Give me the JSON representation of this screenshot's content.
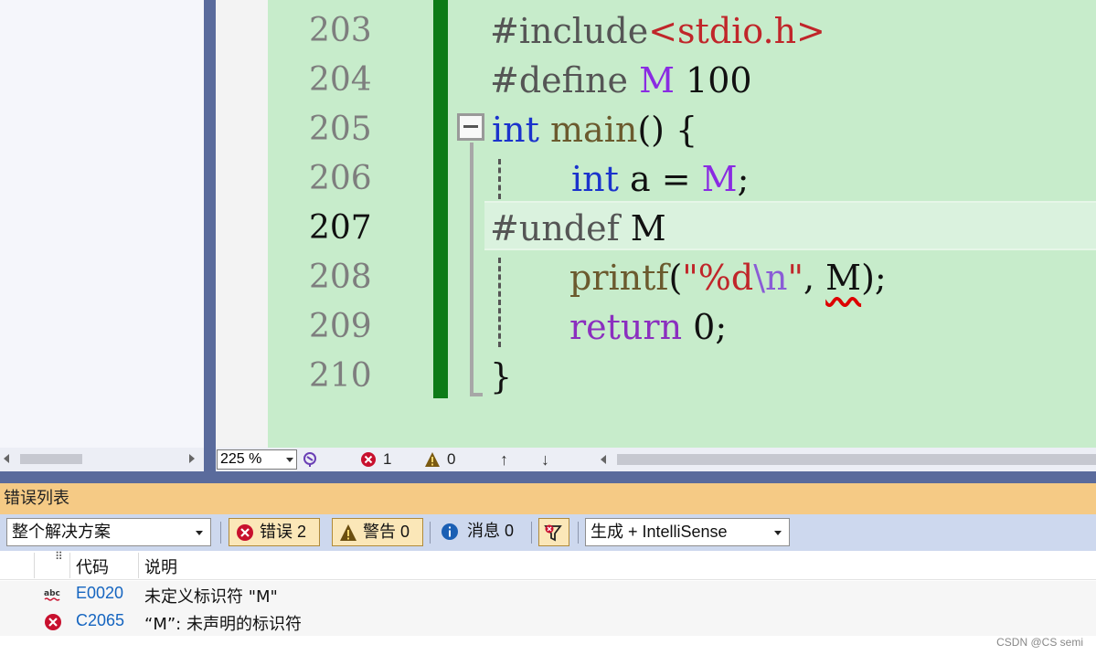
{
  "editor": {
    "lines": [
      {
        "num": "203"
      },
      {
        "num": "204"
      },
      {
        "num": "205"
      },
      {
        "num": "206"
      },
      {
        "num": "207"
      },
      {
        "num": "208"
      },
      {
        "num": "209"
      },
      {
        "num": "210"
      }
    ],
    "current_line": "207",
    "code": {
      "l203_kw": "#include",
      "l203_hdr": "<stdio.h>",
      "l204_kw": "#define",
      "l204_mac": "M",
      "l204_val": "100",
      "l205_type": "int",
      "l205_fn": "main",
      "l205_rest": "() {",
      "l206_type": "int",
      "l206_mid": "a =",
      "l206_mac": "M",
      "l206_end": ";",
      "l207_kw": "#undef",
      "l207_id": "M",
      "l208_fn": "printf",
      "l208_open": "(",
      "l208_str1": "\"%d",
      "l208_esc": "\\n",
      "l208_str2": "\"",
      "l208_comma": ",",
      "l208_id": "M",
      "l208_close": ");",
      "l209_kw": "return",
      "l209_val": "0;",
      "l210": "}"
    }
  },
  "status_bar": {
    "zoom": "225 %",
    "error_count": "1",
    "warning_count": "0",
    "up_arrow": "↑",
    "down_arrow": "↓"
  },
  "error_list": {
    "title": "错误列表",
    "scope_select": "整个解决方案",
    "errors_button": "错误 2",
    "warnings_button": "警告 0",
    "messages_button": "消息 0",
    "source_select": "生成 + IntelliSense",
    "columns": {
      "code": "代码",
      "description": "说明"
    },
    "rows": [
      {
        "icon": "intellisense-spell-icon",
        "code": "E0020",
        "description": "未定义标识符 \"M\""
      },
      {
        "icon": "error-icon",
        "code": "C2065",
        "description": "“M”: 未声明的标识符"
      }
    ]
  },
  "watermark": "CSDN @CS semi",
  "colors": {
    "editor_bg": "#c7eccb",
    "change_bar": "#0d7b17",
    "divider": "#5a6b9c",
    "error_list_title_bg": "#f5ca85",
    "toolbar_bg": "#cdd8ee",
    "keyword": "#1b33cc",
    "macro": "#8a2be2",
    "string": "#c0262a",
    "error_red": "#c8102e"
  }
}
